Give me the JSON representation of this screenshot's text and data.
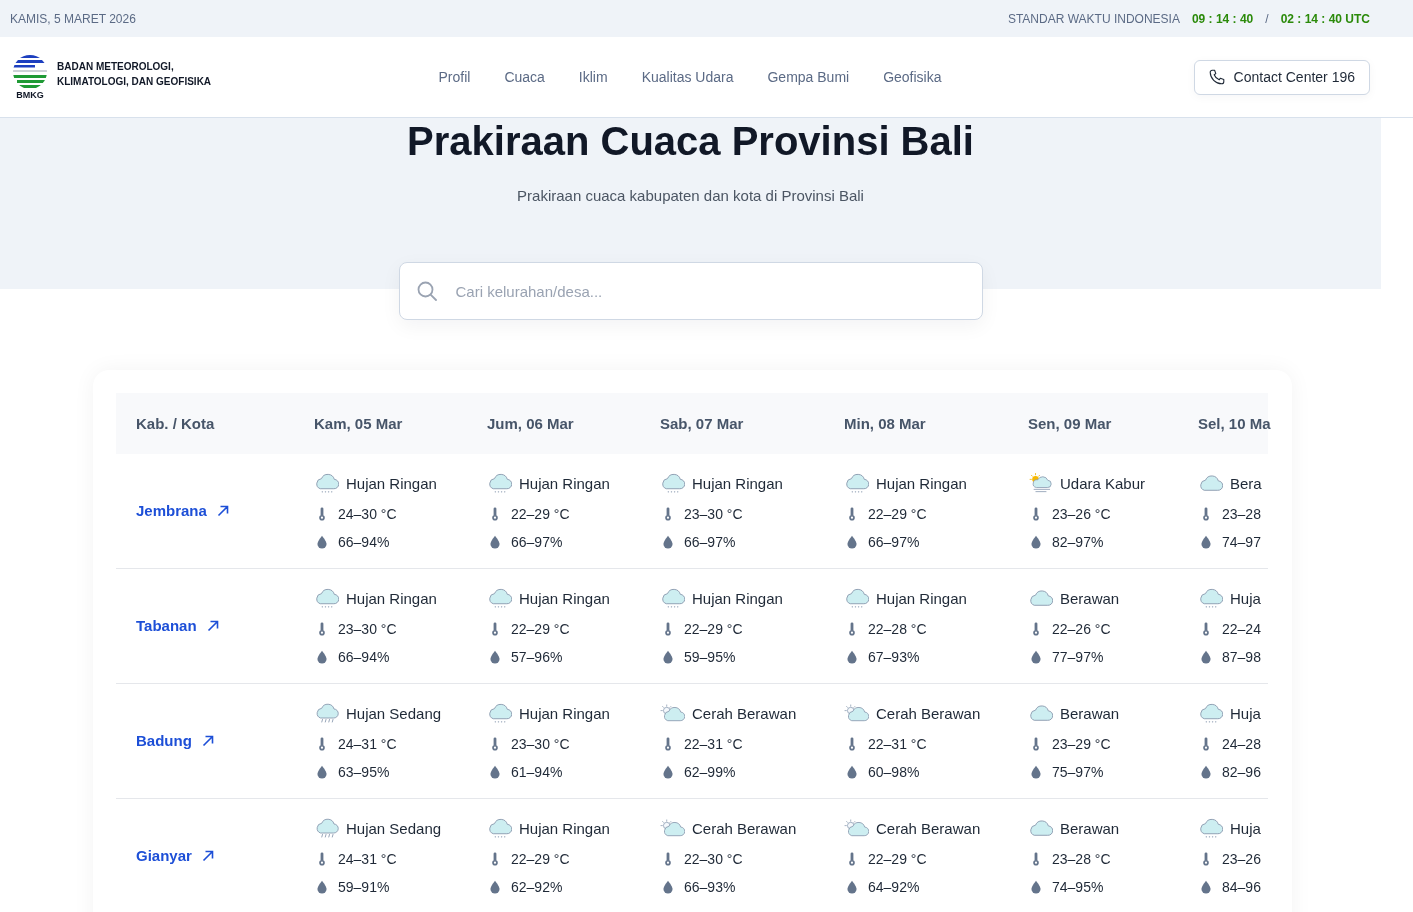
{
  "top_bar": {
    "date": "KAMIS, 5 MARET 2026",
    "time_label": "STANDAR WAKTU INDONESIA",
    "local_time": "09 : 14 : 40",
    "separator": "/",
    "utc_time": "02 : 14 : 40 UTC"
  },
  "header": {
    "logo_text": "BMKG",
    "org_name": "BADAN METEOROLOGI, KLIMATOLOGI, DAN GEOFISIKA",
    "nav": [
      "Profil",
      "Cuaca",
      "Iklim",
      "Kualitas Udara",
      "Gempa Bumi",
      "Geofisika"
    ],
    "contact_button": "Contact Center 196"
  },
  "hero": {
    "title": "Prakiraan Cuaca Provinsi Bali",
    "subtitle": "Prakiraan cuaca kabupaten dan kota di Provinsi Bali"
  },
  "search": {
    "placeholder": "Cari kelurahan/desa..."
  },
  "table": {
    "columns": [
      "Kab. / Kota",
      "Kam, 05 Mar",
      "Jum, 06 Mar",
      "Sab, 07 Mar",
      "Min, 08 Mar",
      "Sen, 09 Mar",
      "Sel, 10 Ma"
    ],
    "rows": [
      {
        "region": "Jembrana",
        "days": [
          {
            "kind": "light_rain",
            "condition": "Hujan Ringan",
            "temperature": "24–30 °C",
            "humidity": "66–94%"
          },
          {
            "kind": "light_rain",
            "condition": "Hujan Ringan",
            "temperature": "22–29 °C",
            "humidity": "66–97%"
          },
          {
            "kind": "light_rain",
            "condition": "Hujan Ringan",
            "temperature": "23–30 °C",
            "humidity": "66–97%"
          },
          {
            "kind": "light_rain",
            "condition": "Hujan Ringan",
            "temperature": "22–29 °C",
            "humidity": "66–97%"
          },
          {
            "kind": "haze",
            "condition": "Udara Kabur",
            "temperature": "23–26 °C",
            "humidity": "82–97%"
          },
          {
            "kind": "cloudy",
            "condition": "Bera",
            "temperature": "23–28",
            "humidity": "74–97"
          }
        ]
      },
      {
        "region": "Tabanan",
        "days": [
          {
            "kind": "light_rain",
            "condition": "Hujan Ringan",
            "temperature": "23–30 °C",
            "humidity": "66–94%"
          },
          {
            "kind": "light_rain",
            "condition": "Hujan Ringan",
            "temperature": "22–29 °C",
            "humidity": "57–96%"
          },
          {
            "kind": "light_rain",
            "condition": "Hujan Ringan",
            "temperature": "22–29 °C",
            "humidity": "59–95%"
          },
          {
            "kind": "light_rain",
            "condition": "Hujan Ringan",
            "temperature": "22–28 °C",
            "humidity": "67–93%"
          },
          {
            "kind": "cloudy",
            "condition": "Berawan",
            "temperature": "22–26 °C",
            "humidity": "77–97%"
          },
          {
            "kind": "light_rain",
            "condition": "Huja",
            "temperature": "22–24",
            "humidity": "87–98"
          }
        ]
      },
      {
        "region": "Badung",
        "days": [
          {
            "kind": "moderate_rain",
            "condition": "Hujan Sedang",
            "temperature": "24–31 °C",
            "humidity": "63–95%"
          },
          {
            "kind": "light_rain",
            "condition": "Hujan Ringan",
            "temperature": "23–30 °C",
            "humidity": "61–94%"
          },
          {
            "kind": "partly_cloudy",
            "condition": "Cerah Berawan",
            "temperature": "22–31 °C",
            "humidity": "62–99%"
          },
          {
            "kind": "partly_cloudy",
            "condition": "Cerah Berawan",
            "temperature": "22–31 °C",
            "humidity": "60–98%"
          },
          {
            "kind": "cloudy",
            "condition": "Berawan",
            "temperature": "23–29 °C",
            "humidity": "75–97%"
          },
          {
            "kind": "light_rain",
            "condition": "Huja",
            "temperature": "24–28",
            "humidity": "82–96"
          }
        ]
      },
      {
        "region": "Gianyar",
        "days": [
          {
            "kind": "moderate_rain",
            "condition": "Hujan Sedang",
            "temperature": "24–31 °C",
            "humidity": "59–91%"
          },
          {
            "kind": "light_rain",
            "condition": "Hujan Ringan",
            "temperature": "22–29 °C",
            "humidity": "62–92%"
          },
          {
            "kind": "partly_cloudy",
            "condition": "Cerah Berawan",
            "temperature": "22–30 °C",
            "humidity": "66–93%"
          },
          {
            "kind": "partly_cloudy",
            "condition": "Cerah Berawan",
            "temperature": "22–29 °C",
            "humidity": "64–92%"
          },
          {
            "kind": "cloudy",
            "condition": "Berawan",
            "temperature": "23–28 °C",
            "humidity": "74–95%"
          },
          {
            "kind": "light_rain",
            "condition": "Huja",
            "temperature": "23–26",
            "humidity": "84–96"
          }
        ]
      }
    ]
  }
}
